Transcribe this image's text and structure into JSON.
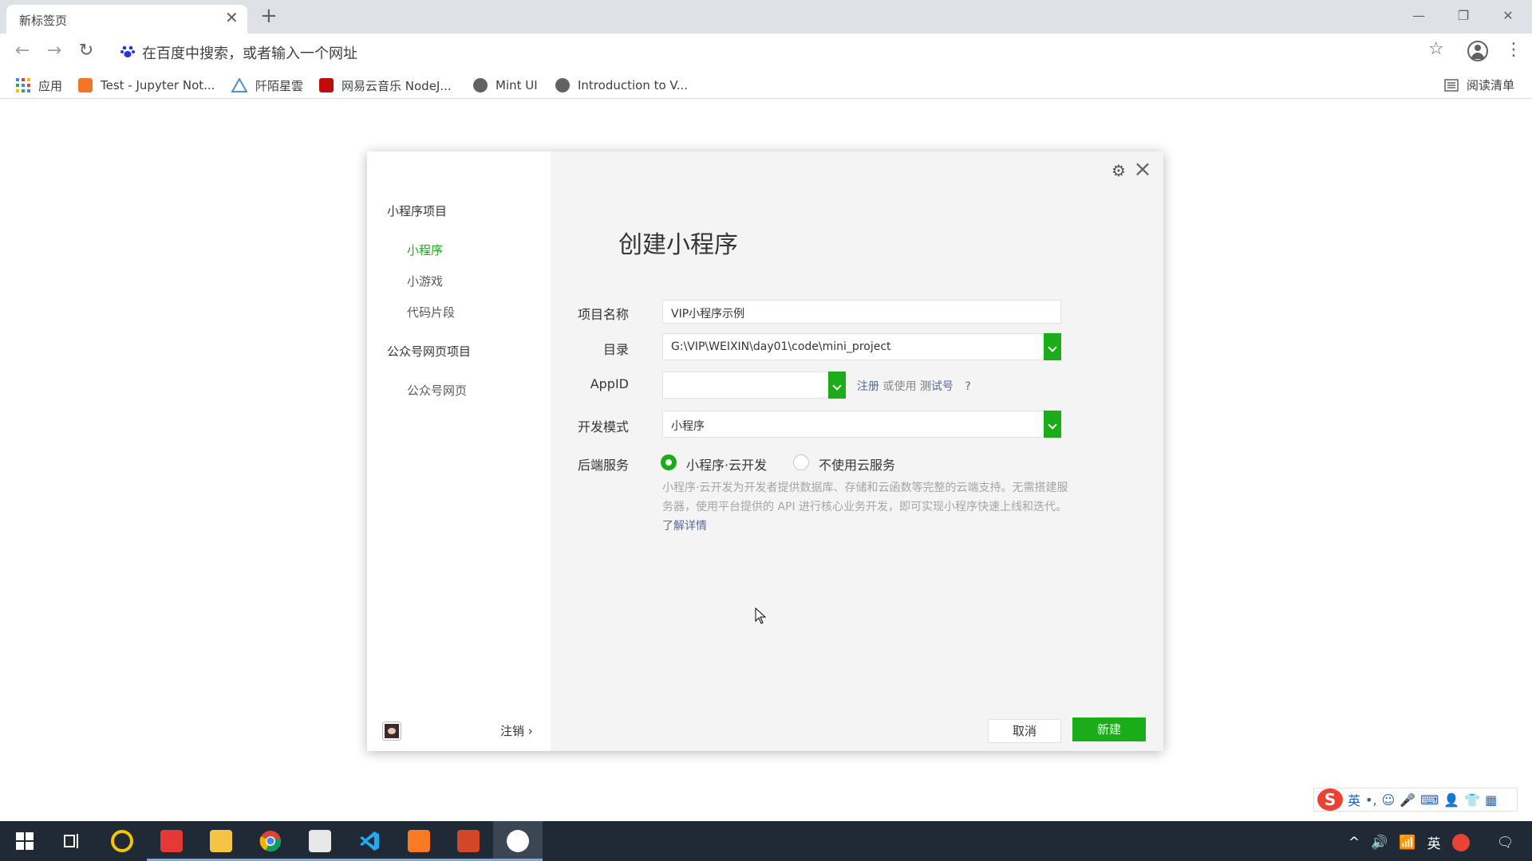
{
  "browser": {
    "tab_title": "新标签页",
    "tab_close": "✕",
    "new_tab": "+",
    "window": {
      "minimize": "—",
      "restore": "❐",
      "close": "✕"
    },
    "nav": {
      "back": "←",
      "forward": "→",
      "reload": "↻"
    },
    "omnibox_placeholder": "在百度中搜索，或者输入一个网址",
    "star": "☆",
    "menu": "⋮",
    "bookmarks": [
      {
        "label": "应用",
        "icon": "apps-grid-icon",
        "color": "#4285f4"
      },
      {
        "label": "Test - Jupyter Not...",
        "icon": "jupyter-icon",
        "color": "#f37626"
      },
      {
        "label": "阡陌星雲",
        "icon": "triangle-logo-icon",
        "color": "#4a90d9"
      },
      {
        "label": "网易云音乐 NodeJ...",
        "icon": "netease-music-icon",
        "color": "#c20c0c"
      },
      {
        "label": "Mint UI",
        "icon": "globe-icon",
        "color": "#5f6368"
      },
      {
        "label": "Introduction to V...",
        "icon": "globe-icon",
        "color": "#5f6368"
      }
    ],
    "reading_list": "阅读清单"
  },
  "dialog": {
    "sidebar": {
      "groups": [
        {
          "label": "小程序项目",
          "items": [
            "小程序",
            "小游戏",
            "代码片段"
          ]
        },
        {
          "label": "公众号网页项目",
          "items": [
            "公众号网页"
          ]
        }
      ],
      "active_item": "小程序",
      "logout": "注销 ›"
    },
    "title": "创建小程序",
    "form": {
      "project_name_label": "项目名称",
      "project_name_value": "VIP小程序示例",
      "directory_label": "目录",
      "directory_value": "G:\\VIP\\WEIXIN\\day01\\code\\mini_project",
      "appid_label": "AppID",
      "appid_value": "",
      "appid_register": "注册",
      "appid_or_use": " 或使用 ",
      "appid_test": "测试号",
      "appid_help": "?",
      "dev_mode_label": "开发模式",
      "dev_mode_value": "小程序",
      "backend_label": "后端服务",
      "backend_options": [
        "小程序·云开发",
        "不使用云服务"
      ],
      "backend_selected": "小程序·云开发",
      "description": "小程序·云开发为开发者提供数据库、存储和云函数等完整的云端支持。无需搭建服务器，使用平台提供的 API 进行核心业务开发，即可实现小程序快速上线和迭代。",
      "learn_more": "了解详情"
    },
    "buttons": {
      "cancel": "取消",
      "create": "新建"
    }
  },
  "ime": {
    "lang": "英",
    "items": [
      "•,",
      "☺",
      "🎤",
      "⌨",
      "👤",
      "👕",
      "▦"
    ]
  },
  "taskbar": {
    "tray": {
      "chevron": "^",
      "volume": "🔊",
      "network": "📶",
      "lang": "英",
      "notification": "🗨"
    }
  },
  "colors": {
    "accent": "#1aad19",
    "link": "#576b95",
    "taskbar": "#1f2a36"
  }
}
